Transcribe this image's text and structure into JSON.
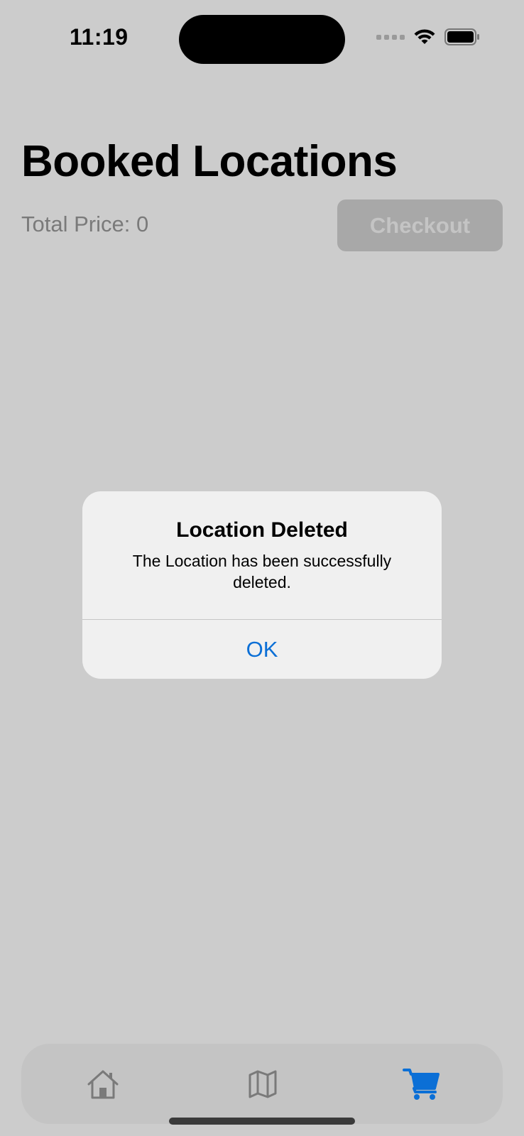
{
  "status_bar": {
    "time": "11:19"
  },
  "header": {
    "title": "Booked Locations",
    "total_price": "Total Price: 0",
    "checkout_label": "Checkout"
  },
  "alert": {
    "title": "Location Deleted",
    "message": "The Location has been successfully deleted.",
    "ok_label": "OK"
  },
  "tab_bar": {
    "items": [
      {
        "icon": "house-icon",
        "active": false
      },
      {
        "icon": "map-icon",
        "active": false
      },
      {
        "icon": "cart-icon",
        "active": true
      }
    ]
  },
  "colors": {
    "background_dimmed": "#cccccc",
    "accent": "#0b6fd6",
    "inactive_icon": "#7a7a7a"
  }
}
